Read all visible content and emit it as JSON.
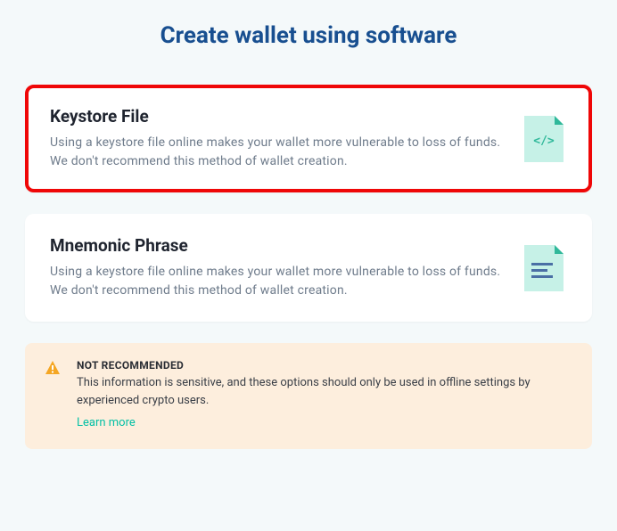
{
  "title": "Create wallet using software",
  "options": [
    {
      "title": "Keystore File",
      "description": "Using a keystore file online makes your wallet more vulnerable to loss of funds. We don't recommend this method of wallet creation.",
      "highlighted": true
    },
    {
      "title": "Mnemonic Phrase",
      "description": "Using a keystore file online makes your wallet more vulnerable to loss of funds. We don't recommend this method of wallet creation.",
      "highlighted": false
    }
  ],
  "warning": {
    "title": "NOT RECOMMENDED",
    "text": "This information is sensitive, and these options should only be used in offline settings by experienced crypto users.",
    "link_label": "Learn more"
  },
  "colors": {
    "accent": "#05c0a5",
    "highlight": "#ef0707",
    "heading": "#184f90",
    "warning_bg": "#fdeedd",
    "warning_icon": "#f5a623"
  }
}
